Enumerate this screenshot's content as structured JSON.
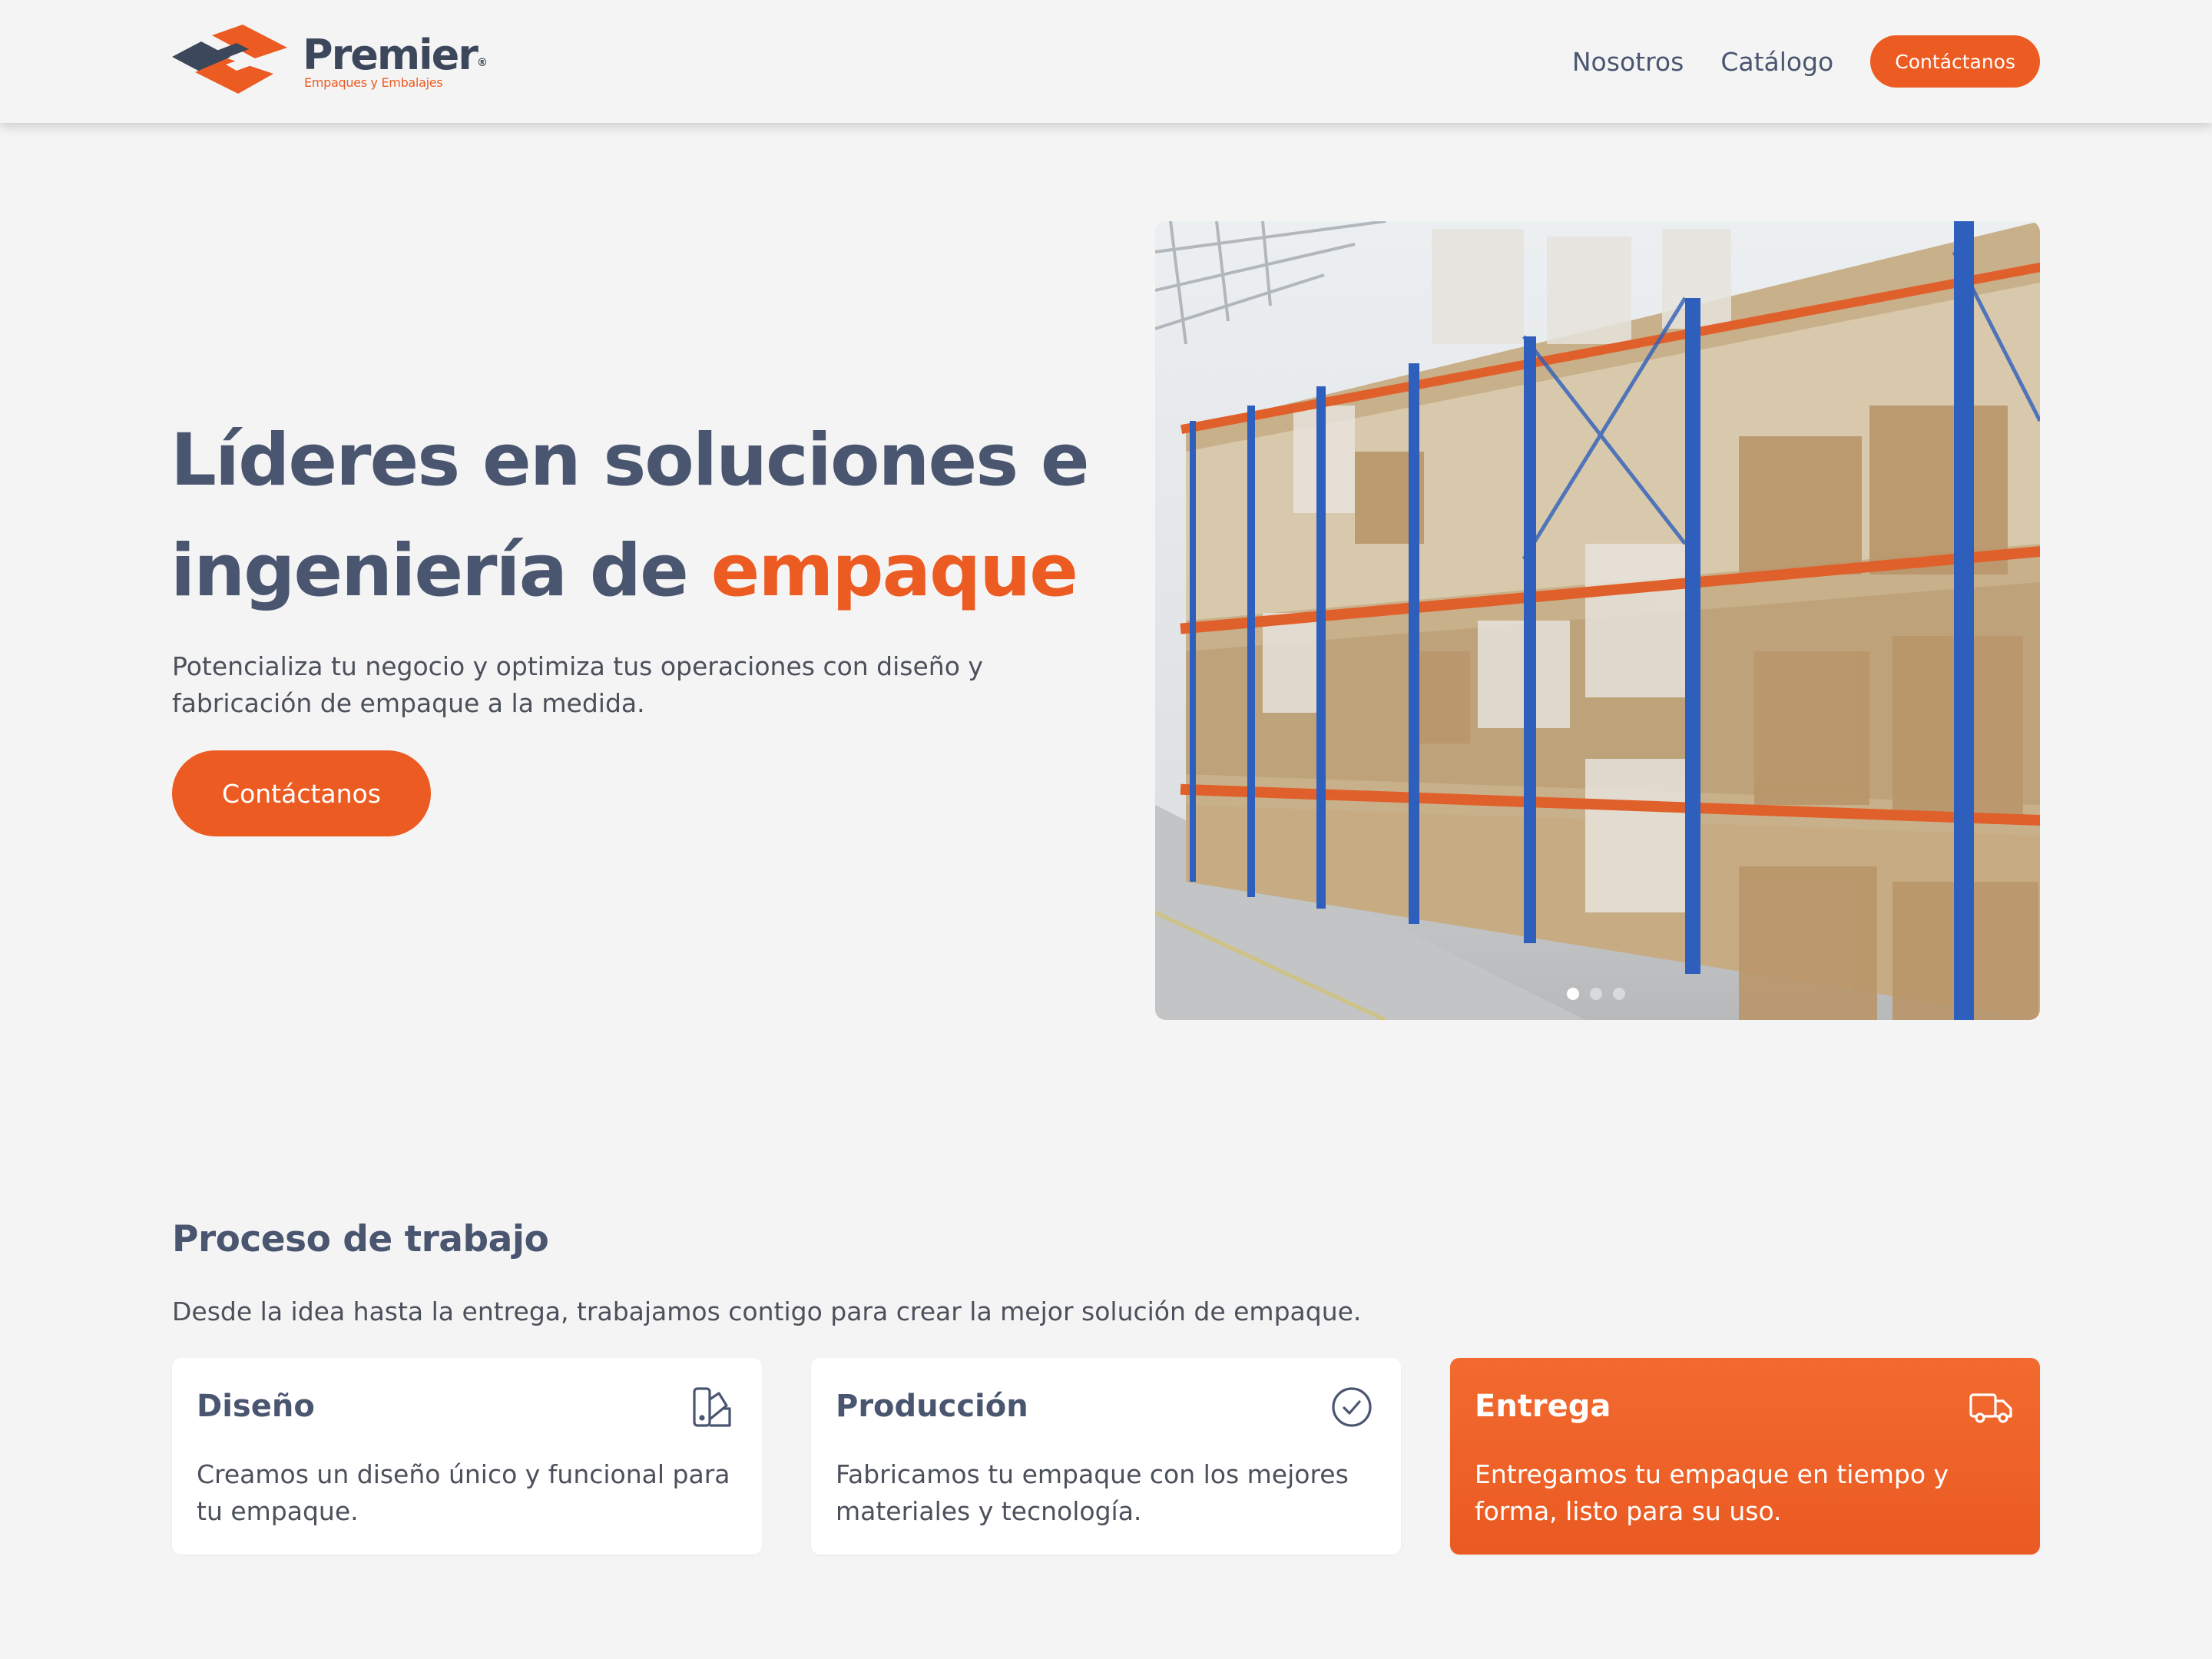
{
  "header": {
    "brand": "Premier",
    "brand_mark": "®",
    "tagline": "Empaques y Embalajes",
    "nav": [
      {
        "label": "Nosotros"
      },
      {
        "label": "Catálogo"
      }
    ],
    "cta_label": "Contáctanos"
  },
  "hero": {
    "title_line1": "Líderes en soluciones e",
    "title_line2_prefix": "ingeniería de ",
    "title_line2_accent": "empaque",
    "subtitle_line1": "Potencializa tu negocio y optimiza tus operaciones con diseño y",
    "subtitle_line2": "fabricación de empaque a la medida.",
    "cta_label": "Contáctanos",
    "image_subject": "warehouse-shelves-with-boxes",
    "carousel": {
      "slides": 3,
      "active": 1
    }
  },
  "process": {
    "title": "Proceso de trabajo",
    "subtitle": "Desde la idea hasta la entrega, trabajamos contigo para crear la mejor solución de empaque.",
    "cards": [
      {
        "title": "Diseño",
        "icon": "swatch-book-icon",
        "text_line1": "Creamos un diseño único y funcional para",
        "text_line2": "tu empaque."
      },
      {
        "title": "Producción",
        "icon": "check-circle-icon",
        "text_line1": "Fabricamos tu empaque con los mejores",
        "text_line2": "materiales y tecnología."
      },
      {
        "title": "Entrega",
        "icon": "truck-icon",
        "text_line1": "Entregamos tu empaque en tiempo y",
        "text_line2": "forma, listo para su uso."
      }
    ]
  },
  "colors": {
    "accent": "#ec5b22",
    "heading": "#4a5670",
    "background": "#f4f4f4",
    "card": "#ffffff"
  }
}
